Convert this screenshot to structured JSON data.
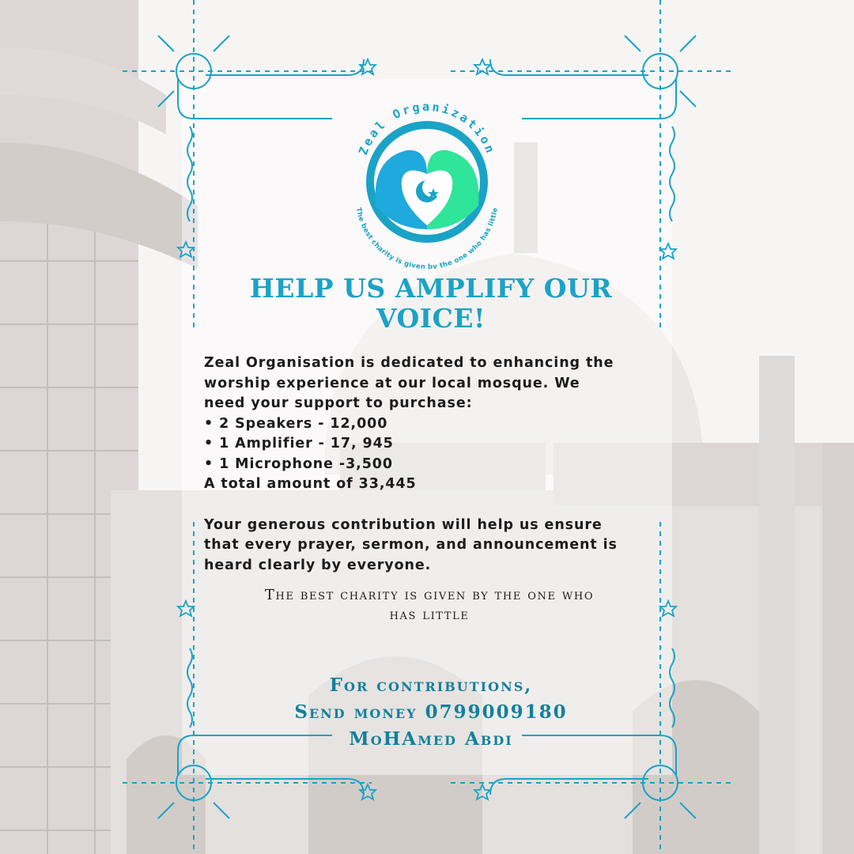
{
  "brand": {
    "name": "Zeal Organization",
    "motto": "The best charity is given by the one who has little",
    "colors": {
      "accent": "#1aa3c6",
      "dark_accent": "#14809b",
      "green": "#2fe59a",
      "blue": "#1fa9dc",
      "text": "#1c1c1c"
    },
    "emblem_icon": "crescent-star-heart-hands-icon"
  },
  "headline": {
    "line1": "HELP US AMPLIFY OUR",
    "line2": "VOICE!"
  },
  "appeal": {
    "intro": [
      "Zeal Organisation is dedicated to enhancing the",
      "worship experience at our local mosque. We",
      "need your support to purchase:"
    ],
    "items": [
      "• 2 Speakers - 12,000",
      "• 1 Amplifier - 17, 945",
      "• 1 Microphone -3,500"
    ],
    "total": "A total amount of 33,445",
    "closing": [
      "Your generous contribution will help us ensure",
      "that every prayer, sermon, and announcement is",
      "heard clearly by everyone."
    ]
  },
  "quote": {
    "line1": "The best charity is given by the one who",
    "line2": "has little"
  },
  "contact": {
    "line1": "For contributions,",
    "line2": "Send money 0799009180",
    "line3": "MoHAmed Abdi"
  },
  "decor": {
    "background": "mosque-dome-minaret-photo",
    "frame": "ornamental-corner-frame",
    "icons": [
      "star-outline-icon",
      "circle-ornament-icon"
    ]
  }
}
